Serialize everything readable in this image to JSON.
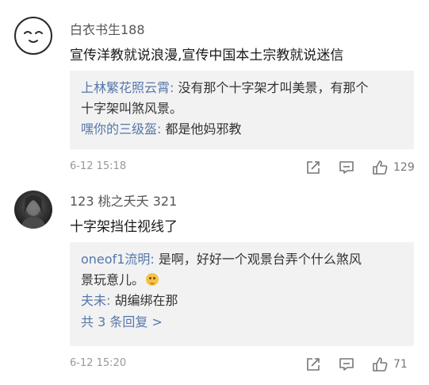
{
  "comments": [
    {
      "avatar_icon": "smiley-face-avatar",
      "username": "白衣书生188",
      "content": "宣传洋教就说浪漫,宣传中国本土宗教就说迷信",
      "replies": [
        {
          "name": "上林繁花照云霄:",
          "text_line1": " 没有那个十字架才叫美景，有那个",
          "text_line2": "十字架叫煞风景。"
        },
        {
          "name": "嘿你的三级盔:",
          "text": " 都是他妈邪教"
        }
      ],
      "timestamp": "6-12 15:18",
      "likes": "129"
    },
    {
      "avatar_icon": "photo-avatar",
      "username": "123 桃之夭夭 321",
      "content": "十字架挡住视线了",
      "replies": [
        {
          "name": "oneof1流明:",
          "text_line1": " 是啊，好好一个观景台弄个什么煞风",
          "text_line2": "景玩意儿。"
        },
        {
          "name": "夫未:",
          "text": " 胡编绑在那"
        }
      ],
      "more_replies": "共 3 条回复 >",
      "timestamp": "6-12 15:20",
      "likes": "71"
    }
  ],
  "icons": {
    "share": "share-icon",
    "reply": "comment-icon",
    "like": "thumbs-up-icon",
    "emoji": "grin-emoji-icon"
  },
  "colors": {
    "reply_name": "#5577aa",
    "reply_bg": "#f2f2f2",
    "meta": "#999999"
  }
}
